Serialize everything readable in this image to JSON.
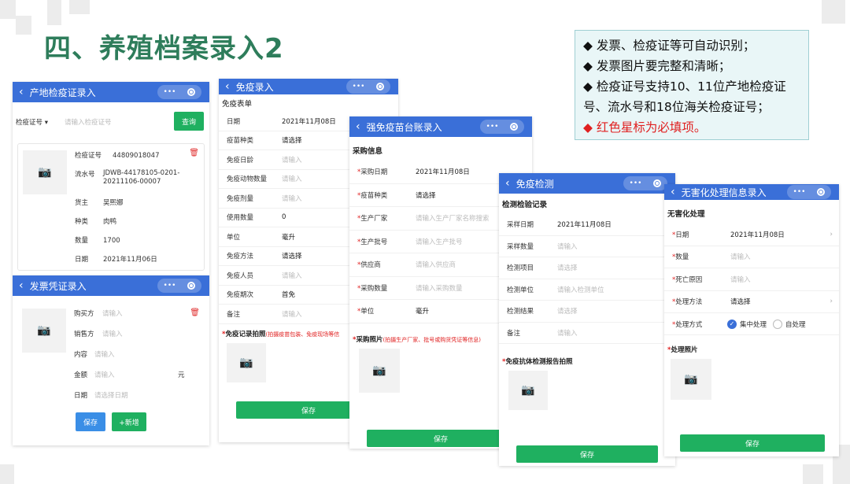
{
  "slide": {
    "title": "四、养殖档案录入2",
    "notes": [
      {
        "text": "◆ 发票、检疫证等可自动识别；",
        "red": false
      },
      {
        "text": "◆ 发票图片要完整和清晰；",
        "red": false
      },
      {
        "text": "◆ 检疫证号支持10、11位产地检疫证号、流水号和18位海关检疫证号；",
        "red": false
      },
      {
        "text": "◆ 红色星标为必填项。",
        "red": true
      }
    ]
  },
  "origin_quarantine": {
    "title": "产地检疫证录入",
    "search_select": "检疫证号 ▾",
    "search_placeholder": "请输入检疫证号",
    "query_button": "查询",
    "card": [
      {
        "k": "检疫证号",
        "v": "44809018047"
      },
      {
        "k": "流水号",
        "v": "JDWB-44178105-0201-20211106-00007"
      },
      {
        "k": "货主",
        "v": "吴熙娜"
      },
      {
        "k": "种类",
        "v": "肉鸭"
      },
      {
        "k": "数量",
        "v": "1700"
      },
      {
        "k": "日期",
        "v": "2021年11月06日"
      }
    ]
  },
  "invoice": {
    "title": "发票凭证录入",
    "fields": [
      {
        "k": "购买方",
        "ph": "请输入"
      },
      {
        "k": "销售方",
        "ph": "请输入"
      },
      {
        "k": "内容",
        "ph": "请输入"
      },
      {
        "k": "金额",
        "ph": "请输入",
        "unit": "元"
      },
      {
        "k": "日期",
        "ph": "请选择日期"
      }
    ],
    "save_button": "保存",
    "add_button": "+新增"
  },
  "immunization": {
    "title": "免疫录入",
    "section": "免疫表单",
    "rows": [
      {
        "k": "日期",
        "v": "2021年11月08日",
        "ph": false
      },
      {
        "k": "疫苗种类",
        "v": "请选择",
        "ph": false
      },
      {
        "k": "免疫日龄",
        "v": "请输入",
        "ph": true
      },
      {
        "k": "免疫动物数量",
        "v": "请输入",
        "ph": true
      },
      {
        "k": "免疫剂量",
        "v": "请输入",
        "ph": true
      },
      {
        "k": "使用数量",
        "v": "0",
        "ph": false
      },
      {
        "k": "单位",
        "v": "毫升",
        "ph": false
      },
      {
        "k": "免疫方法",
        "v": "请选择",
        "ph": false
      },
      {
        "k": "免疫人员",
        "v": "请输入",
        "ph": true
      },
      {
        "k": "免疫期次",
        "v": "首免",
        "ph": false
      },
      {
        "k": "备注",
        "v": "请输入",
        "ph": true
      }
    ],
    "photo_label": "免疫记录拍照",
    "photo_hint": "(拍摄疫苗包装、免疫现场等信",
    "save_button": "保存"
  },
  "vaccine_ledger": {
    "title": "强免疫苗台账录入",
    "section": "采购信息",
    "rows": [
      {
        "k": "采购日期",
        "v": "2021年11月08日",
        "ph": false
      },
      {
        "k": "疫苗种类",
        "v": "请选择",
        "ph": false
      },
      {
        "k": "生产厂家",
        "v": "请输入生产厂家名称搜索",
        "ph": true
      },
      {
        "k": "生产批号",
        "v": "请输入生产批号",
        "ph": true
      },
      {
        "k": "供应商",
        "v": "请输入供应商",
        "ph": true
      },
      {
        "k": "采购数量",
        "v": "请输入采购数量",
        "ph": true
      },
      {
        "k": "单位",
        "v": "毫升",
        "ph": false
      }
    ],
    "photo_label": "采购照片",
    "photo_hint": "(拍摄生产厂家、批号或购货凭证等信息)",
    "save_button": "保存"
  },
  "immune_test": {
    "title": "免疫检测",
    "section": "检测检验记录",
    "rows": [
      {
        "k": "采样日期",
        "v": "2021年11月08日",
        "ph": false
      },
      {
        "k": "采样数量",
        "v": "请输入",
        "ph": true
      },
      {
        "k": "检测项目",
        "v": "请选择",
        "ph": true
      },
      {
        "k": "检测单位",
        "v": "请输入检测单位",
        "ph": true
      },
      {
        "k": "检测结果",
        "v": "请选择",
        "ph": true
      },
      {
        "k": "备注",
        "v": "请输入",
        "ph": true
      }
    ],
    "photo_label": "免疫抗体检测报告拍照",
    "save_button": "保存"
  },
  "harmless": {
    "title": "无害化处理信息录入",
    "section": "无害化处理",
    "rows": [
      {
        "k": "日期",
        "v": "2021年11月08日",
        "ph": false
      },
      {
        "k": "数量",
        "v": "请输入",
        "ph": true
      },
      {
        "k": "死亡原因",
        "v": "请输入",
        "ph": true
      },
      {
        "k": "处理方法",
        "v": "请选择",
        "ph": false
      }
    ],
    "method_label": "处理方式",
    "option_central": "集中处理",
    "option_self": "自处理",
    "photo_label": "处理照片",
    "save_button": "保存"
  }
}
